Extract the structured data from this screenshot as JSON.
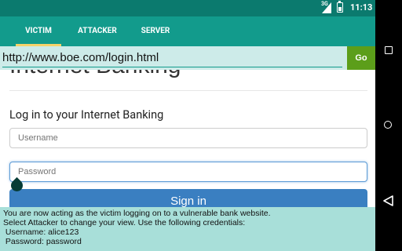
{
  "status_bar": {
    "network": "3G",
    "time": "11:13"
  },
  "tabs": [
    {
      "label": "VICTIM",
      "active": true
    },
    {
      "label": "ATTACKER",
      "active": false
    },
    {
      "label": "SERVER",
      "active": false
    }
  ],
  "url_bar": {
    "url": "http://www.boe.com/login.html",
    "go_label": "Go"
  },
  "page": {
    "title": "Internet Banking",
    "login_heading": "Log in to your Internet Banking",
    "username_placeholder": "Username",
    "password_placeholder": "Password",
    "signin_label": "Sign in"
  },
  "info_panel": {
    "lines": [
      "You are now acting as the victim logging on to a vulnerable bank website.",
      "Select Attacker to change your view. Use the following credentials:",
      " Username: alice123",
      " Password: password"
    ]
  },
  "nav_bar": {
    "buttons": [
      "recents-icon",
      "home-icon",
      "back-icon"
    ]
  },
  "colors": {
    "status_bar": "#0b7a6e",
    "tab_bar": "#129b8c",
    "tab_indicator": "#f5d36a",
    "url_bar_bg": "#cdebe9",
    "go_button": "#5c9e1a",
    "signin_button": "#3a7fc1",
    "info_panel_bg": "#a8dfd9"
  }
}
